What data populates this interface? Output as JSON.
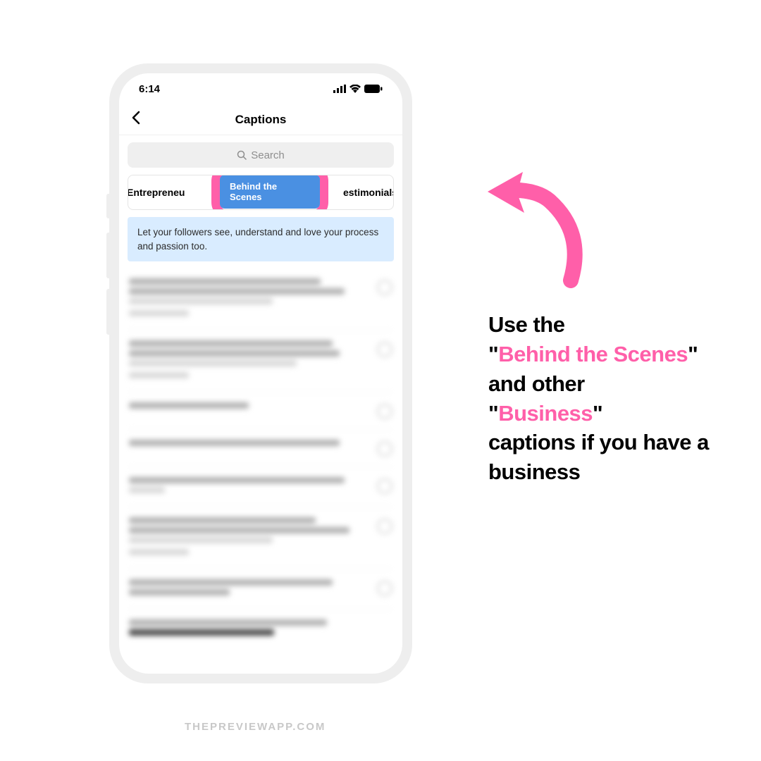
{
  "status": {
    "time": "6:14"
  },
  "nav": {
    "title": "Captions"
  },
  "search": {
    "placeholder": "Search"
  },
  "tabs": {
    "left": "Entrepreneu",
    "center": "Behind the Scenes",
    "right": "estimonials"
  },
  "banner": "Let your followers see, understand and love your process and passion too.",
  "callout": {
    "p1": "Use the",
    "q1a": "\"",
    "q1b": "Behind the Scenes",
    "q1c": "\"",
    "p2": "and other",
    "q2a": "\"",
    "q2b": "Business",
    "q2c": "\"",
    "p3": "captions if you have a business"
  },
  "footer": "THEPREVIEWAPP.COM"
}
